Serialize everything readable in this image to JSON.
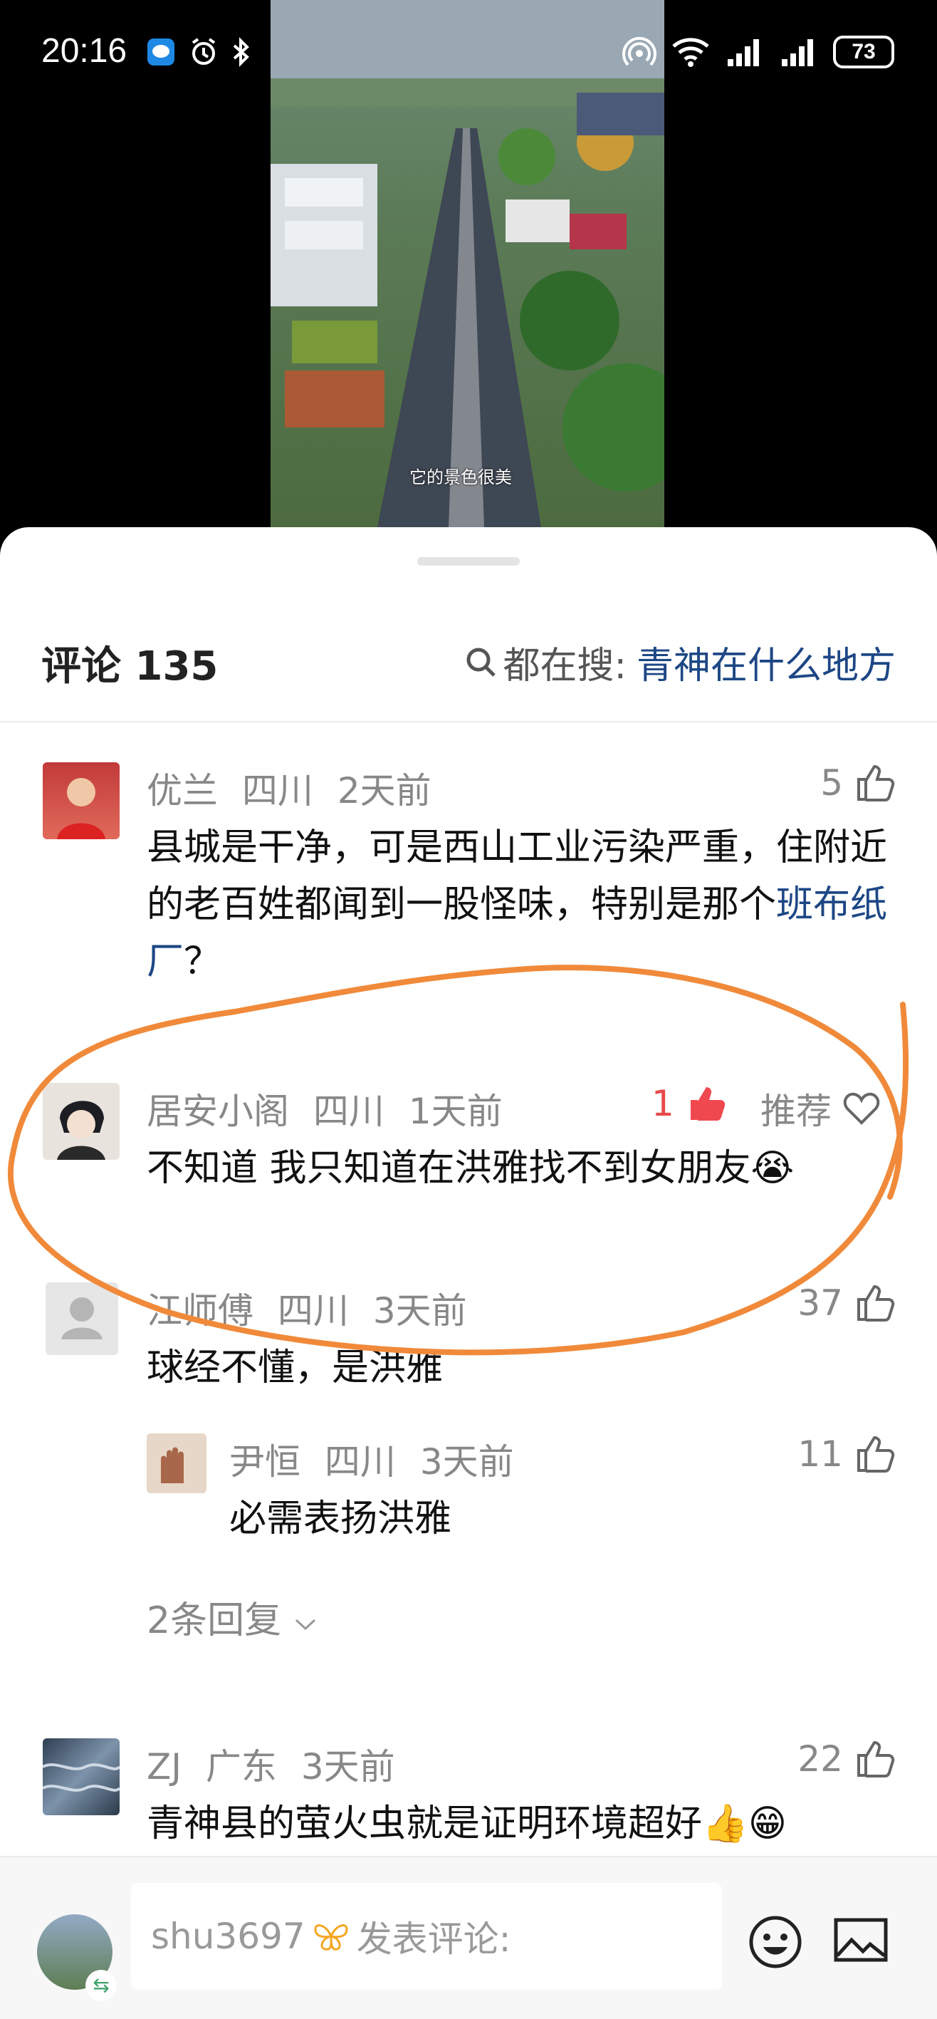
{
  "status_bar": {
    "time": "20:16",
    "battery": "73"
  },
  "video": {
    "subtitle": "它的景色很美"
  },
  "comments_panel": {
    "title": "评论 135",
    "search_label": "都在搜:",
    "search_keyword": "青神在什么地方"
  },
  "comments": [
    {
      "user": "优兰",
      "location": "四川",
      "time": "2天前",
      "likes": "5",
      "text_part1": "县城是干净，可是西山工业污染严重，住附近的老百姓都闻到一股怪味，特别是那个",
      "text_link": "班布纸厂",
      "text_part2": "？"
    },
    {
      "user": "居安小阁",
      "location": "四川",
      "time": "1天前",
      "likes": "1",
      "recommend": "推荐",
      "text": "不知道  我只知道在洪雅找不到女朋友😭"
    },
    {
      "user": "江师傅",
      "location": "四川",
      "time": "3天前",
      "likes": "37",
      "text": "球经不懂，是洪雅",
      "reply": {
        "user": "尹恒",
        "location": "四川",
        "time": "3天前",
        "likes": "11",
        "text": "必需表扬洪雅"
      },
      "replies_toggle": "2条回复"
    },
    {
      "user": "ZJ",
      "location": "广东",
      "time": "3天前",
      "likes": "22",
      "text": "青神县的萤火虫就是证明环境超好👍😁"
    }
  ],
  "bottom_bar": {
    "username": "shu3697",
    "placeholder": "发表评论:"
  }
}
